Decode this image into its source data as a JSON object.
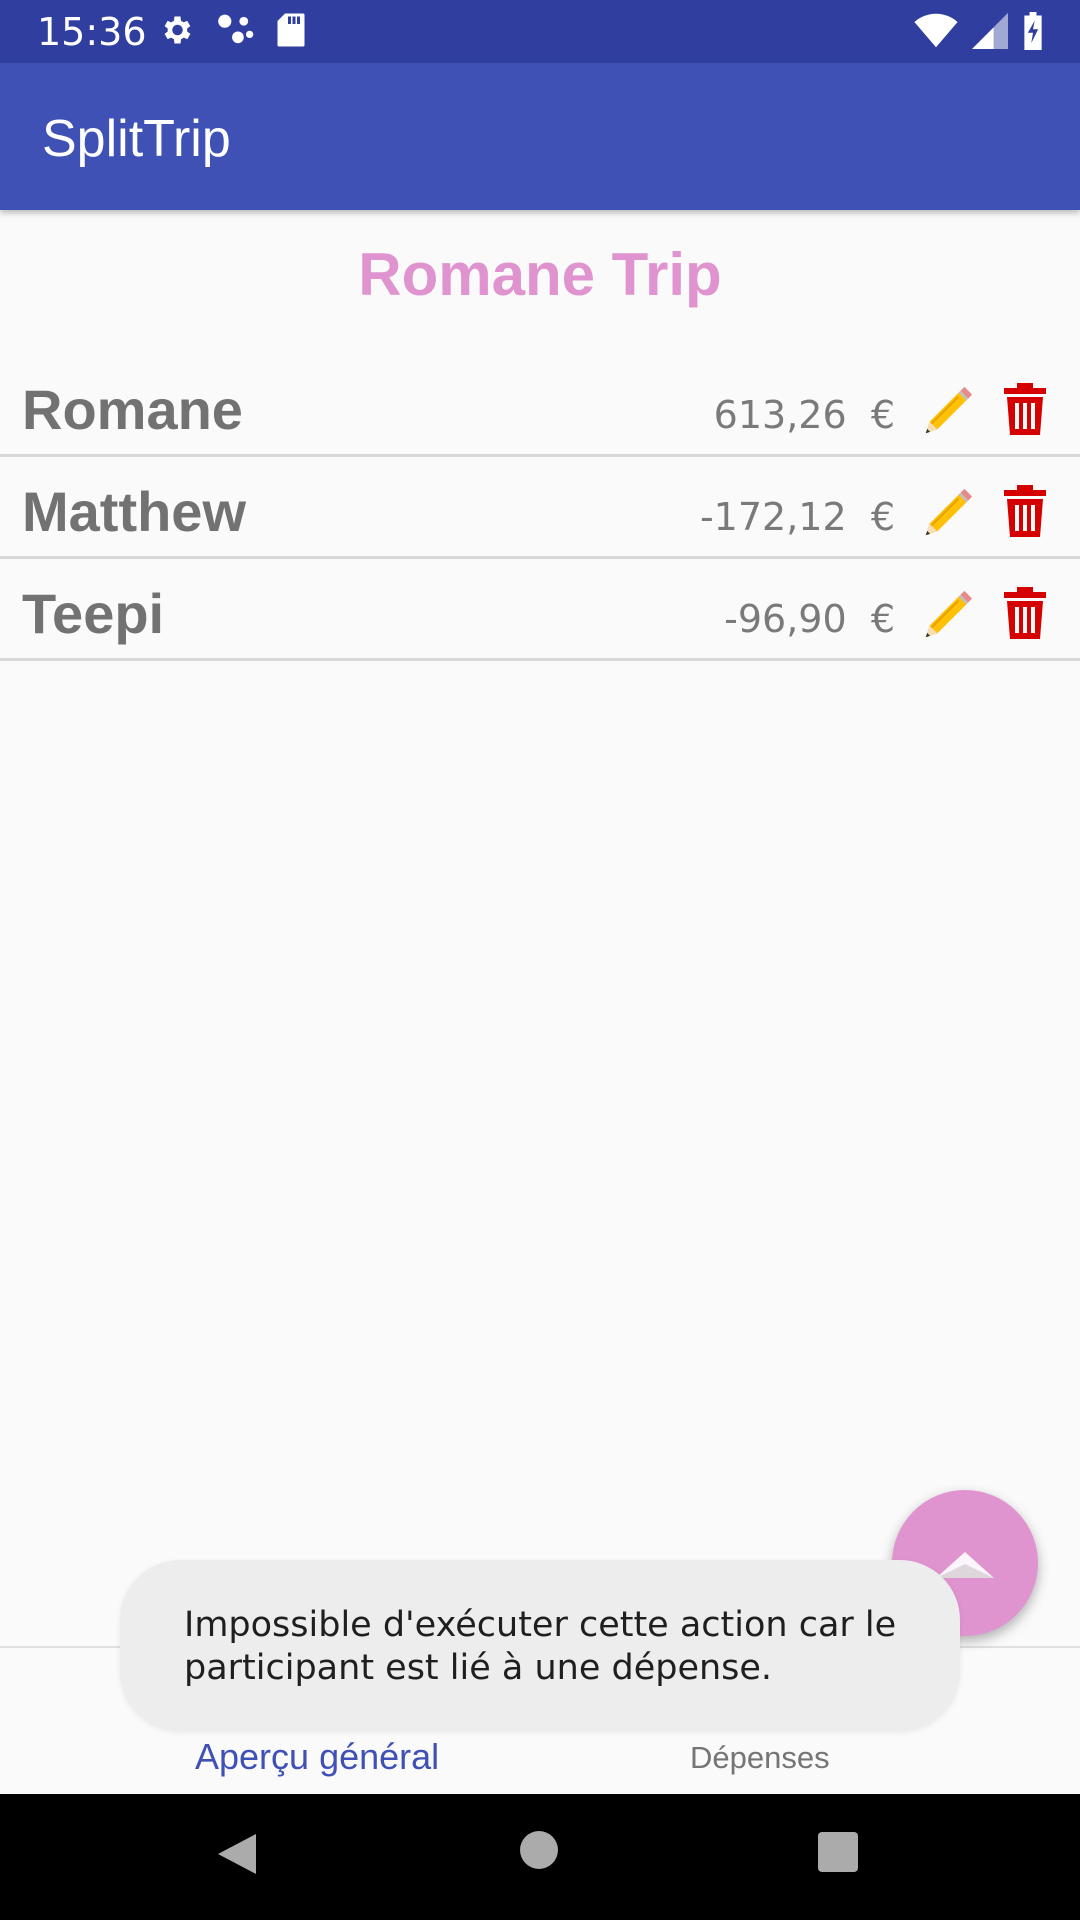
{
  "status_bar": {
    "time": "15:36",
    "icons": [
      "gear-icon",
      "share-dots-icon",
      "sd-card-icon",
      "wifi-icon",
      "signal-icon",
      "battery-charging-icon"
    ]
  },
  "app_bar": {
    "title": "SplitTrip"
  },
  "trip": {
    "title": "Romane Trip"
  },
  "participants": [
    {
      "name": "Romane",
      "amount": "613,26",
      "currency": "€"
    },
    {
      "name": "Matthew",
      "amount": "-172,12",
      "currency": "€"
    },
    {
      "name": "Teepi",
      "amount": "-96,90",
      "currency": "€"
    }
  ],
  "row_icons": {
    "edit": "pencil-icon",
    "delete": "trash-icon"
  },
  "fab": {
    "icon": "chevron-up-icon"
  },
  "toast": {
    "message": "Impossible d'exécuter cette action car le participant est lié à une dépense."
  },
  "tabs": {
    "overview": "Aperçu général",
    "expenses": "Dépenses"
  },
  "colors": {
    "status_bar": "#303f9f",
    "app_bar": "#3f51b5",
    "accent_pink": "#e094cf",
    "delete_red": "#d50000",
    "active_tab": "#3f51b5"
  }
}
